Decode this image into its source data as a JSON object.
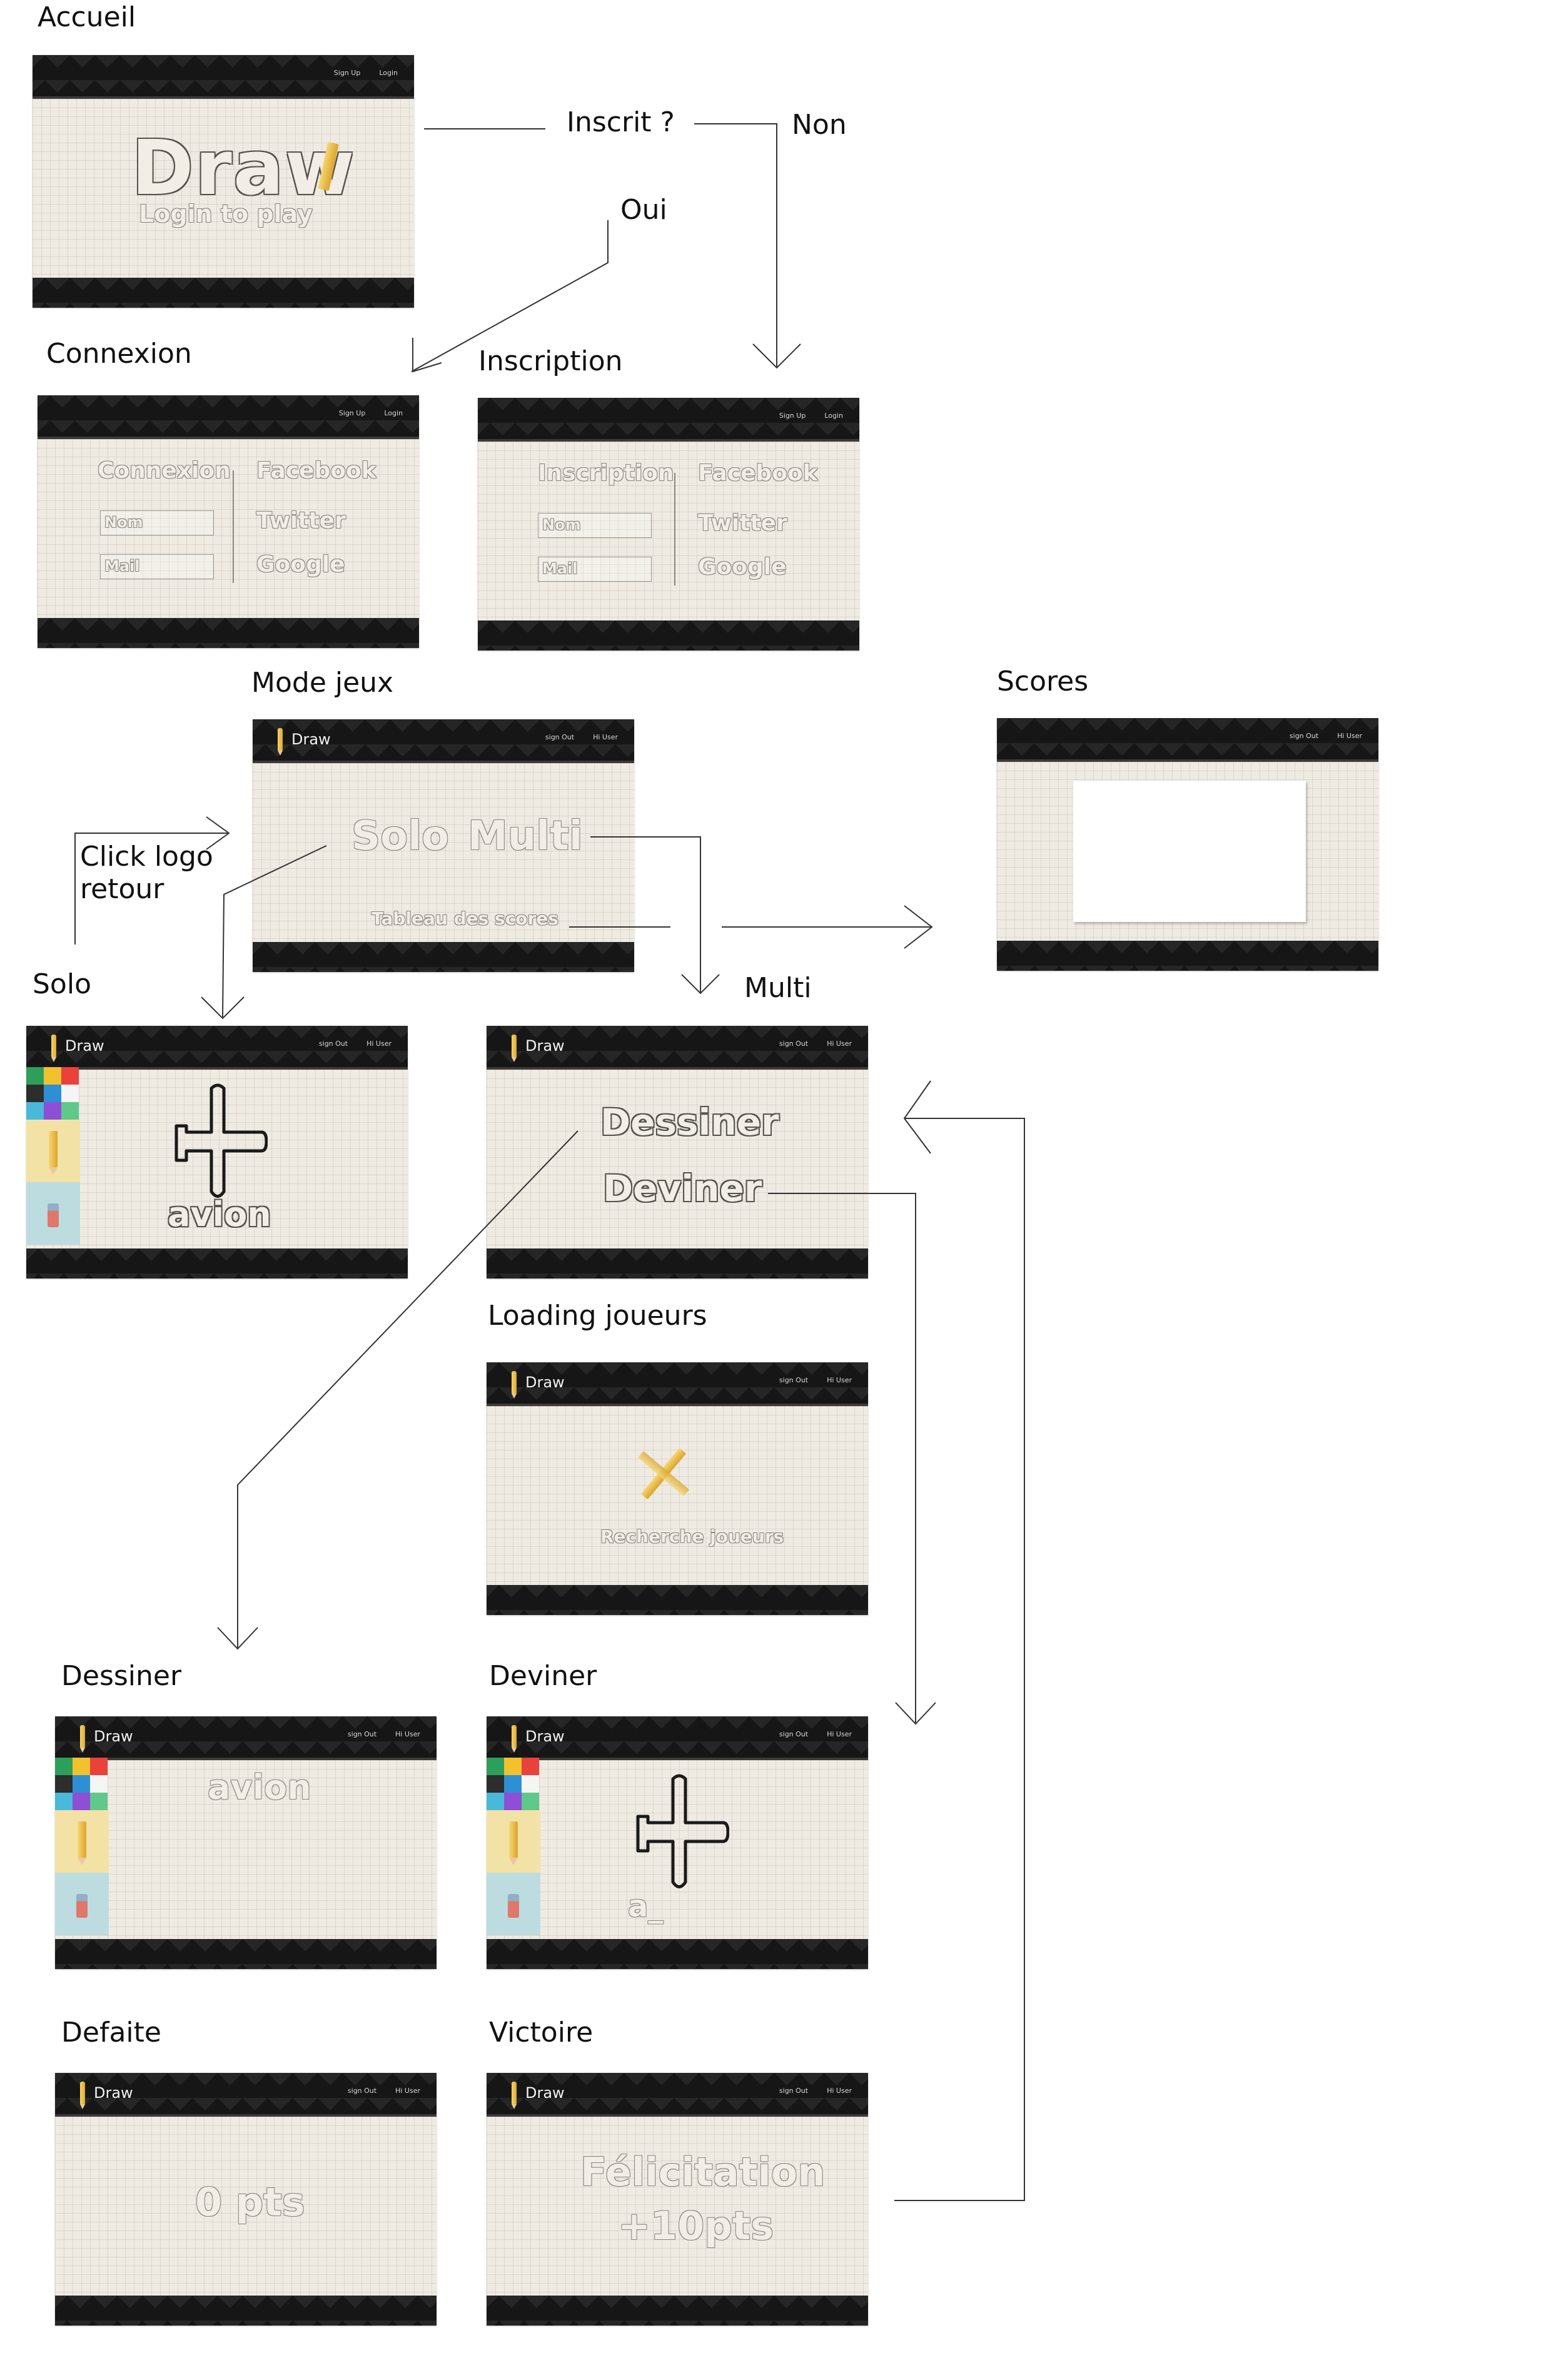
{
  "section_labels": {
    "accueil": "Accueil",
    "connexion": "Connexion",
    "inscription": "Inscription",
    "mode_jeux": "Mode jeux",
    "scores": "Scores",
    "solo": "Solo",
    "multi": "Multi",
    "loading": "Loading joueurs",
    "dessiner": "Dessiner",
    "deviner": "Deviner",
    "defaite": "Defaite",
    "victoire": "Victoire"
  },
  "flow_labels": {
    "inscrit": "Inscrit ?",
    "non": "Non",
    "oui": "Oui",
    "click_logo_1": "Click logo",
    "click_logo_2": "retour"
  },
  "nav_guest": {
    "signup": "Sign Up",
    "login": "Login"
  },
  "nav_user": {
    "signout": "sign Out",
    "hi": "Hi User"
  },
  "brand": "Draw",
  "accueil": {
    "logo": "Draw",
    "subtitle": "Login to play"
  },
  "connexion": {
    "title": "Connexion",
    "nom": "Nom",
    "mail": "Mail",
    "facebook": "Facebook",
    "twitter": "Twitter",
    "google": "Google"
  },
  "inscription": {
    "title": "Inscription",
    "nom": "Nom",
    "mail": "Mail",
    "facebook": "Facebook",
    "twitter": "Twitter",
    "google": "Google"
  },
  "mode_jeux": {
    "solo": "Solo",
    "multi": "Multi",
    "scores": "Tableau des scores"
  },
  "solo": {
    "word": "avion"
  },
  "multi": {
    "dessiner": "Dessiner",
    "deviner": "Deviner"
  },
  "loading": {
    "text": "Recherche joueurs"
  },
  "dessiner": {
    "word": "avion"
  },
  "deviner": {
    "guess": "a_"
  },
  "defaite": {
    "points": "0 pts"
  },
  "victoire": {
    "line1": "Félicitation",
    "line2": "+10pts"
  },
  "palette_colors": [
    "#2e9f5a",
    "#f2c12e",
    "#e8423a",
    "#2d2d2d",
    "#2f8fd4",
    "#f5f5f5",
    "#49b8d9",
    "#8e4fd6",
    "#5ec98b"
  ],
  "icons": [
    "pencil-icon",
    "eraser-icon",
    "airplane-icon",
    "arrow-icon"
  ]
}
